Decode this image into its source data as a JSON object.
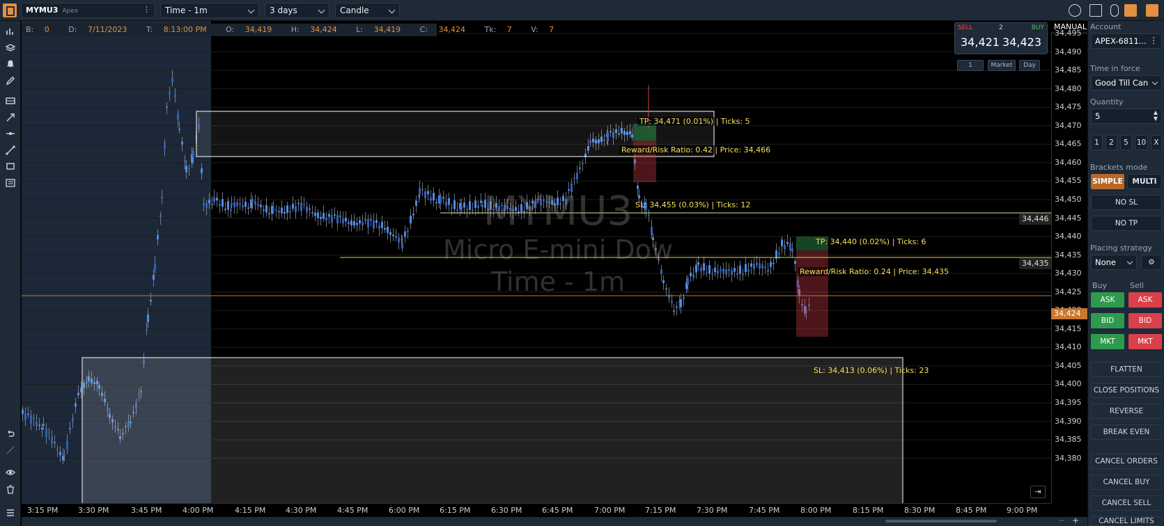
{
  "toolbar": {
    "symbol": "MYMU3",
    "broker": "Apex",
    "timeframe": "Time - 1m",
    "range": "3 days",
    "chart_type": "Candle"
  },
  "infobar": {
    "b_label": "B:",
    "b_value": "0",
    "d_label": "D:",
    "d_value": "7/11/2023",
    "t_label": "T:",
    "t_value": "8:13:00 PM",
    "o_label": "O:",
    "o_value": "34,419",
    "h_label": "H:",
    "h_value": "34,424",
    "l_label": "L:",
    "l_value": "34,419",
    "c_label": "C:",
    "c_value": "34,424",
    "tk_label": "Tk:",
    "tk_value": "7",
    "v_label": "V:",
    "v_value": "7"
  },
  "watermark": {
    "line1": "MYMU3",
    "line2": "Micro E-mini Dow",
    "line3": "Time - 1m"
  },
  "annotations": {
    "tp1": "TP: 34,471 (0.01%) | Ticks: 5",
    "rr1": "Reward/Risk Ratio: 0.42 | Price: 34,466",
    "sl1": "SL: 34,455 (0.03%) | Ticks: 12",
    "tp2": "TP: 34,440 (0.02%) | Ticks: 6",
    "rr2": "Reward/Risk Ratio: 0.24 | Price: 34,435",
    "sl2": "SL: 34,413 (0.06%) | Ticks: 23",
    "tag1": "34,446",
    "tag2": "34,435"
  },
  "mode_label": "MANUAL",
  "current_price": "34,424",
  "y_ticks": [
    "34,495",
    "34,490",
    "34,485",
    "34,480",
    "34,475",
    "34,470",
    "34,465",
    "34,460",
    "34,455",
    "34,450",
    "34,445",
    "34,440",
    "34,435",
    "34,430",
    "34,425",
    "34,420",
    "34,415",
    "34,410",
    "34,405",
    "34,400",
    "34,395",
    "34,390",
    "34,385",
    "34,380"
  ],
  "x_ticks": [
    "3:15 PM",
    "3:30 PM",
    "3:45 PM",
    "4:00 PM",
    "4:15 PM",
    "4:30 PM",
    "4:45 PM",
    "6:00 PM",
    "6:15 PM",
    "6:30 PM",
    "6:45 PM",
    "7:00 PM",
    "7:15 PM",
    "7:30 PM",
    "7:45 PM",
    "8:00 PM",
    "8:15 PM",
    "8:30 PM",
    "8:45 PM",
    "9:00 PM"
  ],
  "quote": {
    "sell_label": "SELL",
    "count": "2",
    "buy_label": "BUY",
    "bid": "34,421",
    "ask": "34,423",
    "qty_btn": "1",
    "market_btn": "Market",
    "day_btn": "Day"
  },
  "panel": {
    "account_label": "Account",
    "account_value": "APEX-6811...",
    "tif_label": "Time in force",
    "tif_value": "Good Till Can",
    "qty_label": "Quantity",
    "qty_value": "5",
    "qty_presets": [
      "1",
      "2",
      "5",
      "10",
      "X"
    ],
    "brackets_label": "Brackets mode",
    "simple": "SIMPLE",
    "multi": "MULTI",
    "no_sl": "NO SL",
    "no_tp": "NO TP",
    "placing_label": "Placing strategy",
    "placing_value": "None",
    "buy_label": "Buy",
    "sell_label": "Sell",
    "ask": "ASK",
    "bid": "BID",
    "mkt": "MKT",
    "flatten": "FLATTEN",
    "close_positions": "CLOSE POSITIONS",
    "reverse": "REVERSE",
    "break_even": "BREAK EVEN",
    "cancel_orders": "CANCEL ORDERS",
    "cancel_buy": "CANCEL BUY",
    "cancel_sell": "CANCEL SELL",
    "cancel_limits": "CANCEL LIMITS"
  },
  "colors": {
    "accent": "#e39043",
    "candle": "#3f7fe0",
    "annotation": "#f5e05a",
    "buy": "#2e9a4e",
    "sell": "#d9404a"
  }
}
